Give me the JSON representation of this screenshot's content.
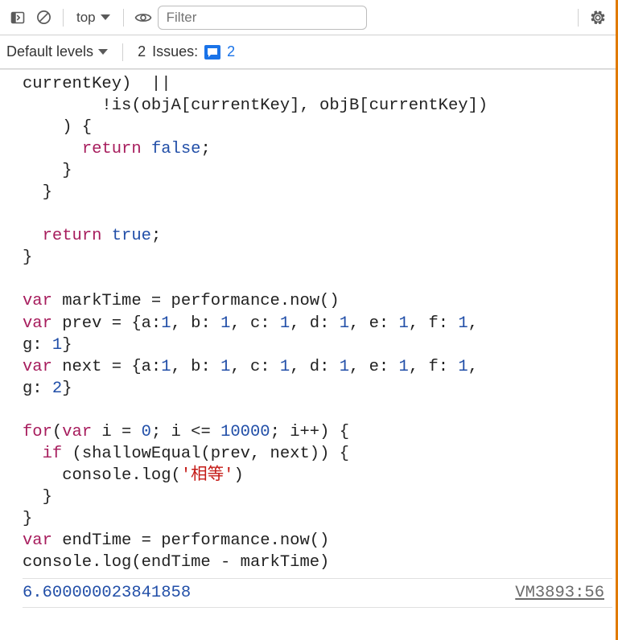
{
  "toolbar": {
    "context": "top",
    "filter_placeholder": "Filter"
  },
  "subbar": {
    "levels_label": "Default levels",
    "issues_label": "Issues:",
    "issues_count": "2",
    "issues_badge_count": "2"
  },
  "code": {
    "l1": "currentKey)  ||",
    "l2a": "        !is(objA[currentKey], objB[currentKey])",
    "l2b": "    ) {",
    "l3a": "      ",
    "l3b": "return",
    "l3c": " ",
    "l3d": "false",
    "l3e": ";",
    "l4": "    }",
    "l5": "  }",
    "blank": "",
    "l6a": "  ",
    "l6b": "return",
    "l6c": " ",
    "l6d": "true",
    "l6e": ";",
    "l7": "}",
    "l8a": "var",
    "l8b": " markTime = performance.now()",
    "l9a": "var",
    "l9b": " prev = {a:",
    "l9c": "1",
    "l9d": ", b: ",
    "l9e": "1",
    "l9f": ", c: ",
    "l9g": "1",
    "l9h": ", d: ",
    "l9i": "1",
    "l9j": ", e: ",
    "l9k": "1",
    "l9l": ", f: ",
    "l9m": "1",
    "l9n": ", ",
    "l9o": "g: ",
    "l9p": "1",
    "l9q": "}",
    "l10a": "var",
    "l10b": " next = {a:",
    "l10c": "1",
    "l10d": ", b: ",
    "l10e": "1",
    "l10f": ", c: ",
    "l10g": "1",
    "l10h": ", d: ",
    "l10i": "1",
    "l10j": ", e: ",
    "l10k": "1",
    "l10l": ", f: ",
    "l10m": "1",
    "l10n": ", ",
    "l10o": "g: ",
    "l10p": "2",
    "l10q": "}",
    "l11a": "for",
    "l11b": "(",
    "l11c": "var",
    "l11d": " i = ",
    "l11e": "0",
    "l11f": "; i <= ",
    "l11g": "10000",
    "l11h": "; i++) {",
    "l12a": "  ",
    "l12b": "if",
    "l12c": " (shallowEqual(prev, next)) {",
    "l13a": "    console.log(",
    "l13b": "'相等'",
    "l13c": ")",
    "l14": "  }",
    "l15": "}",
    "l16a": "var",
    "l16b": " endTime = performance.now()",
    "l17": "console.log(endTime - markTime)"
  },
  "output": {
    "value": "6.600000023841858",
    "source": "VM3893:56"
  }
}
